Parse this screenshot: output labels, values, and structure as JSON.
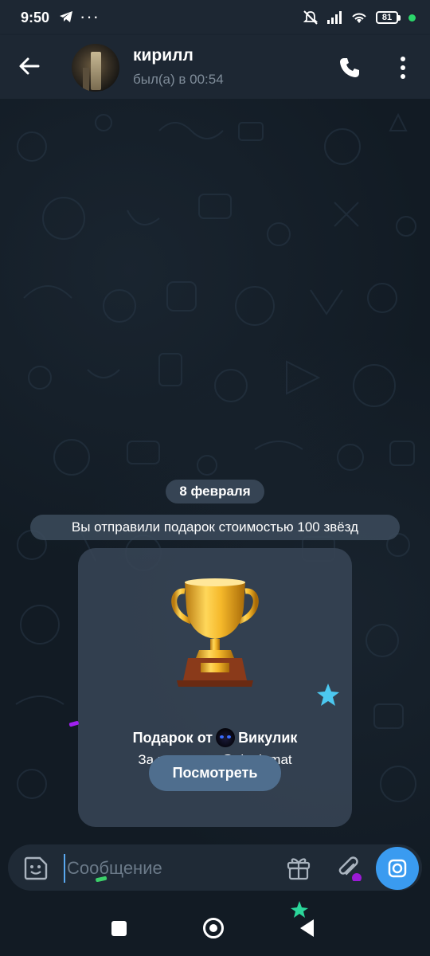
{
  "status_bar": {
    "time": "9:50",
    "battery": "81",
    "icons": [
      "telegram-icon",
      "more-dots",
      "mute-icon",
      "signal-icon",
      "wifi-icon",
      "battery-icon"
    ]
  },
  "header": {
    "name": "кирилл",
    "status": "был(а) в 00:54"
  },
  "chat": {
    "date": "8 февраля",
    "service_message": "Вы отправили подарок стоимостью 100 звёзд",
    "gift": {
      "from_label": "Подарок от",
      "from_name": "Викулик",
      "description": "За конкурс в @victriamat",
      "button": "Посмотреть"
    }
  },
  "composer": {
    "placeholder": "Сообщение"
  },
  "colors": {
    "header_bg": "#1d2733",
    "chat_bg": "#121b24",
    "accent": "#3a9bf0",
    "button": "#4f6e8e"
  }
}
